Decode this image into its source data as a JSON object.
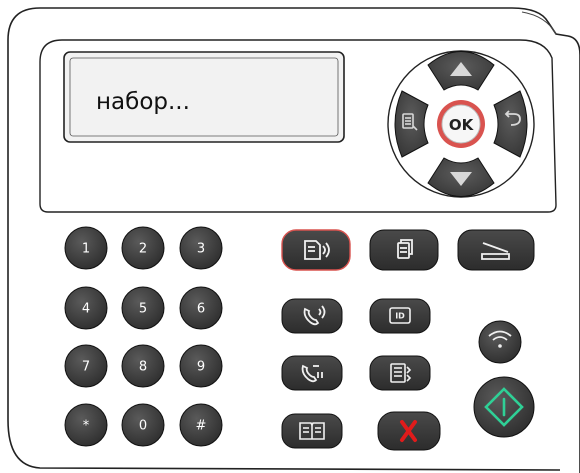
{
  "display": {
    "text": "набор..."
  },
  "navigation": {
    "ok_label": "OK"
  },
  "keypad": {
    "keys": [
      "1",
      "2",
      "3",
      "4",
      "5",
      "6",
      "7",
      "8",
      "9",
      "*",
      "0",
      "#"
    ]
  },
  "colors": {
    "key_fill": "#3b3b3b",
    "ok_ring": "#d9534f",
    "accent_red": "#e01b1b",
    "start_green": "#2fd096",
    "panel_outline": "#222222",
    "lcd_background": "#efefef"
  },
  "icons": {
    "nav_up": "triangle-up-icon",
    "nav_down": "triangle-down-icon",
    "nav_left_menu": "menu-list-icon",
    "nav_right_back": "back-arrow-icon",
    "fax_mode": "fax-mode-icon",
    "copy_mode": "copy-icon",
    "scan_mode": "scan-icon",
    "redial": "redial-phone-icon",
    "id_copy": "id-card-icon",
    "speed_dial": "speed-dial-icon",
    "wifi": "wifi-icon",
    "address_book": "address-book-icon",
    "stop": "stop-x-icon",
    "start": "start-diamond-icon"
  }
}
